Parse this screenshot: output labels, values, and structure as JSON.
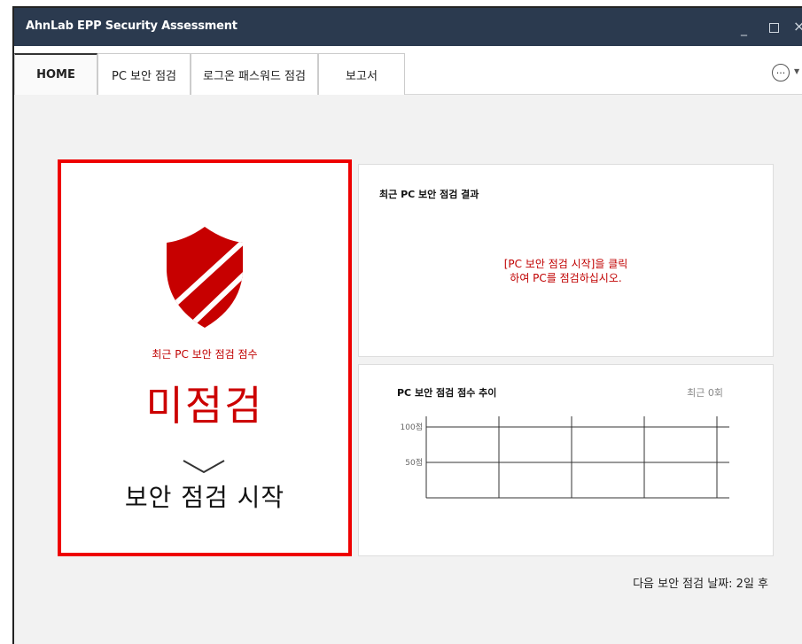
{
  "window": {
    "title": "AhnLab EPP Security Assessment",
    "controls": {
      "minimize": "_",
      "close": "×"
    }
  },
  "tabs": [
    {
      "label": "HOME",
      "active": true
    },
    {
      "label": "PC 보안 점검",
      "active": false
    },
    {
      "label": "로그온 패스워드 점검",
      "active": false
    },
    {
      "label": "보고서",
      "active": false
    }
  ],
  "more_menu": {
    "icon": "more-options-icon",
    "glyph": "···"
  },
  "score_card": {
    "icon": "shield-icon",
    "label": "최근 PC 보안 점검 점수",
    "value": "미점검",
    "start_label": "보안 점검 시작",
    "accent_color": "#cc0000"
  },
  "recent_result": {
    "title": "최근 PC 보안 점검 결과",
    "message_line1": "[PC 보안 점검 시작]을 클릭",
    "message_line2": "하여 PC를 점검하십시오."
  },
  "trend": {
    "title": "PC 보안 점검 점수 추이",
    "recent": "최근 0회",
    "y_ticks": [
      "100점",
      "50점"
    ]
  },
  "next_check": "다음 보안 점검 날짜: 2일 후"
}
